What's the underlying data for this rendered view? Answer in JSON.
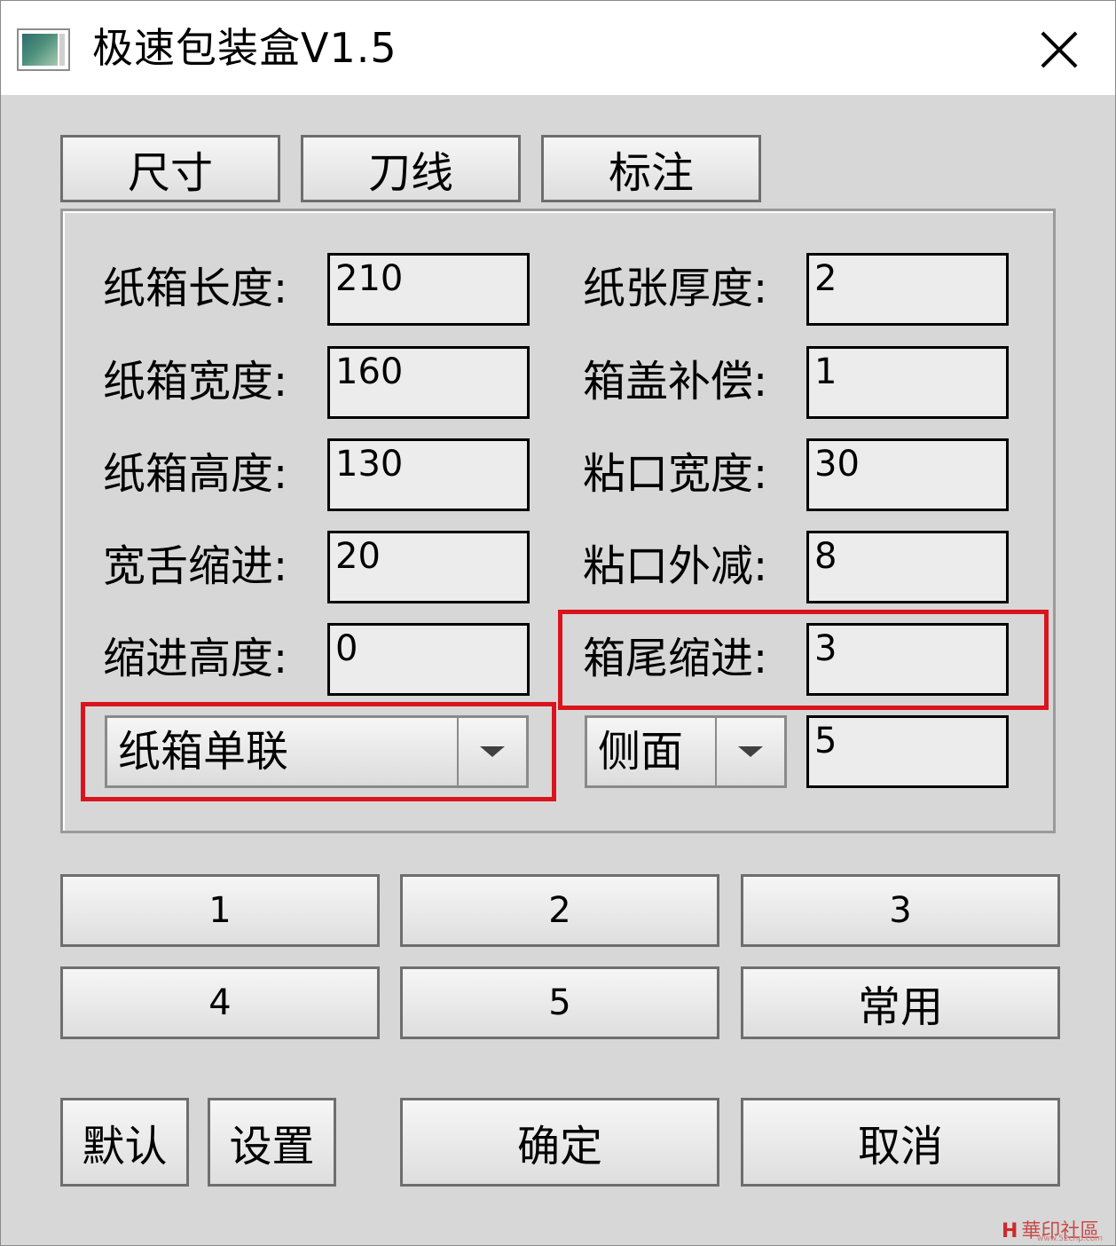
{
  "window": {
    "title": "极速包装盒V1.5",
    "icon": "app-icon",
    "close_icon": "close-icon"
  },
  "tabs": [
    "尺寸",
    "刀线",
    "标注"
  ],
  "fields_left": [
    {
      "label": "纸箱长度:",
      "value": "210"
    },
    {
      "label": "纸箱宽度:",
      "value": "160"
    },
    {
      "label": "纸箱高度:",
      "value": "130"
    },
    {
      "label": "宽舌缩进:",
      "value": "20"
    },
    {
      "label": "缩进高度:",
      "value": "0"
    }
  ],
  "fields_right": [
    {
      "label": "纸张厚度:",
      "value": "2"
    },
    {
      "label": "箱盖补偿:",
      "value": "1"
    },
    {
      "label": "粘口宽度:",
      "value": "30"
    },
    {
      "label": "粘口外减:",
      "value": "8"
    },
    {
      "label": "箱尾缩进:",
      "value": "3"
    }
  ],
  "combo_box_type": {
    "selected": "纸箱单联"
  },
  "combo_side": {
    "selected": "侧面",
    "value": "5"
  },
  "preset_buttons": [
    "1",
    "2",
    "3",
    "4",
    "5",
    "常用"
  ],
  "actions": {
    "default": "默认",
    "settings": "设置",
    "ok": "确定",
    "cancel": "取消"
  },
  "watermark": {
    "text": "華印社區",
    "url": "www.52cnp.com"
  },
  "colors": {
    "highlight": "#d9141c",
    "background": "#d7d7d7"
  }
}
